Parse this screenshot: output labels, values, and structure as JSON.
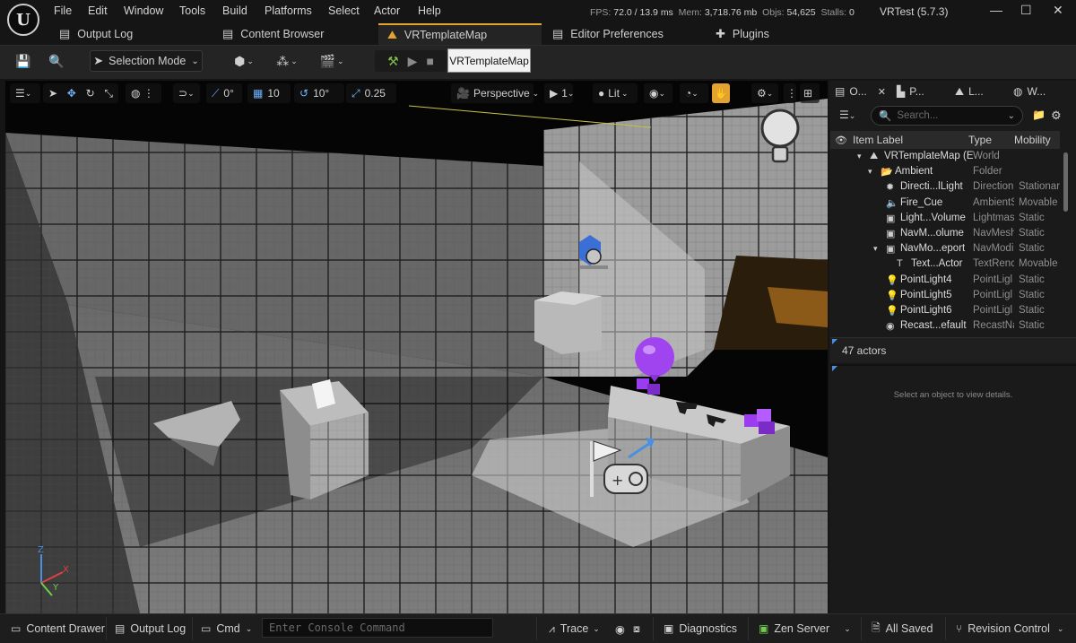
{
  "menu": [
    "File",
    "Edit",
    "Window",
    "Tools",
    "Build",
    "Platforms",
    "Select",
    "Actor",
    "Help"
  ],
  "stats": {
    "fps_label": "FPS:",
    "fps": "72.0",
    "ms": "/ 13.9 ms",
    "mem_label": "Mem:",
    "mem": "3,718.76 mb",
    "objs_label": "Objs:",
    "objs": "54,625",
    "stalls_label": "Stalls:",
    "stalls": "0"
  },
  "project_name": "VRTest (5.7.3)",
  "tabs": {
    "output_log": "Output Log",
    "content_browser": "Content Browser",
    "map": "VRTemplateMap",
    "editor_prefs": "Editor Preferences",
    "plugins": "Plugins"
  },
  "toolbar": {
    "selection_mode": "Selection Mode",
    "tooltip": "VRTemplateMap"
  },
  "viewport": {
    "translate_snap": "0°",
    "grid_size": "10",
    "rotate_snap": "10°",
    "scale_snap": "0.25",
    "perspective": "Perspective",
    "camera_speed": "1",
    "view_mode": "Lit"
  },
  "outliner": {
    "tabs": [
      "O...",
      "P...",
      "L...",
      "W..."
    ],
    "search_placeholder": "Search...",
    "columns": {
      "label": "Item Label",
      "type": "Type",
      "mobility": "Mobility"
    },
    "rows": [
      {
        "label": "VRTemplateMap (E",
        "type": "World",
        "mobility": "",
        "indent": 0,
        "icon": "world-icon",
        "glyph": "⛰",
        "caret": "▾"
      },
      {
        "label": "Ambient",
        "type": "Folder",
        "mobility": "",
        "indent": 1,
        "icon": "folder-icon",
        "glyph": "📂",
        "caret": "▾"
      },
      {
        "label": "Directi...lLight",
        "type": "Direction",
        "mobility": "Stationar",
        "indent": 2,
        "icon": "sun-icon",
        "glyph": "✹",
        "caret": ""
      },
      {
        "label": "Fire_Cue",
        "type": "AmbientS",
        "mobility": "Movable",
        "indent": 2,
        "icon": "speaker-icon",
        "glyph": "🔈",
        "caret": ""
      },
      {
        "label": "Light...Volume",
        "type": "Lightmas",
        "mobility": "Static",
        "indent": 2,
        "icon": "volume-icon",
        "glyph": "▣",
        "caret": ""
      },
      {
        "label": "NavM...olume",
        "type": "NavMesh",
        "mobility": "Static",
        "indent": 2,
        "icon": "navmesh-icon",
        "glyph": "▣",
        "caret": ""
      },
      {
        "label": "NavMo...eport",
        "type": "NavModi",
        "mobility": "Static",
        "indent": 2,
        "icon": "navmodifier-icon",
        "glyph": "▣",
        "caret": "▾"
      },
      {
        "label": "Text...Actor",
        "type": "TextRenc",
        "mobility": "Movable",
        "indent": 3,
        "icon": "text-actor-icon",
        "glyph": "T",
        "caret": ""
      },
      {
        "label": "PointLight4",
        "type": "PointLigl",
        "mobility": "Static",
        "indent": 2,
        "icon": "bulb-icon",
        "glyph": "💡",
        "caret": ""
      },
      {
        "label": "PointLight5",
        "type": "PointLigl",
        "mobility": "Static",
        "indent": 2,
        "icon": "bulb-icon",
        "glyph": "💡",
        "caret": ""
      },
      {
        "label": "PointLight6",
        "type": "PointLigl",
        "mobility": "Static",
        "indent": 2,
        "icon": "bulb-icon",
        "glyph": "💡",
        "caret": ""
      },
      {
        "label": "Recast...efault",
        "type": "RecastNa",
        "mobility": "Static",
        "indent": 2,
        "icon": "recast-icon",
        "glyph": "◉",
        "caret": ""
      }
    ],
    "actor_count": "47 actors"
  },
  "details_hint": "Select an object to view details.",
  "statusbar": {
    "content_drawer": "Content Drawer",
    "output_log": "Output Log",
    "cmd": "Cmd",
    "console_placeholder": "Enter Console Command",
    "trace": "Trace",
    "diagnostics": "Diagnostics",
    "zen_server": "Zen Server",
    "all_saved": "All Saved",
    "revision_control": "Revision Control"
  },
  "colors": {
    "accent": "#e3a330",
    "purple": "#9b3cf0",
    "selection_blue": "#4a8fe0"
  }
}
